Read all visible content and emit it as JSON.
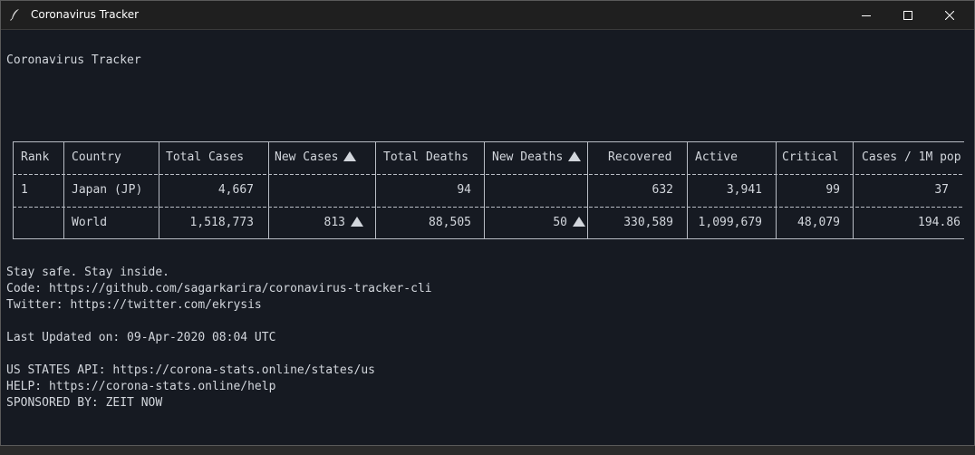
{
  "window": {
    "title": "Coronavirus Tracker",
    "icons": {
      "app": "feather-icon",
      "minimize": "minimize-icon",
      "maximize": "maximize-icon",
      "close": "close-icon"
    }
  },
  "terminal": {
    "heading": "Coronavirus Tracker",
    "table": {
      "headers": {
        "rank": "Rank",
        "country": "Country",
        "total_cases": "Total Cases",
        "new_cases": "New Cases",
        "total_deaths": "Total Deaths",
        "new_deaths": "New Deaths",
        "recovered": "Recovered",
        "active": "Active",
        "critical": "Critical",
        "cases_per_1m": "Cases / 1M pop"
      },
      "rows": [
        {
          "rank": "1",
          "country": "Japan (JP)",
          "total_cases": "4,667",
          "new_cases": "",
          "total_deaths": "94",
          "new_deaths": "",
          "recovered": "632",
          "active": "3,941",
          "critical": "99",
          "cases_per_1m": "37"
        },
        {
          "rank": "",
          "country": "World",
          "total_cases": "1,518,773",
          "new_cases": "813",
          "total_deaths": "88,505",
          "new_deaths": "50",
          "recovered": "330,589",
          "active": "1,099,679",
          "critical": "48,079",
          "cases_per_1m": "194.86"
        }
      ],
      "sort_icon": "triangle-up-icon"
    },
    "footer": {
      "stay_safe": "Stay safe. Stay inside.",
      "code": "Code: https://github.com/sagarkarira/coronavirus-tracker-cli",
      "twitter": "Twitter: https://twitter.com/ekrysis",
      "last_updated": "Last Updated on: 09-Apr-2020 08:04 UTC",
      "us_states_api": "US STATES API: https://corona-stats.online/states/us",
      "help": "HELP: https://corona-stats.online/help",
      "sponsored": "SPONSORED BY: ZEIT NOW"
    }
  }
}
